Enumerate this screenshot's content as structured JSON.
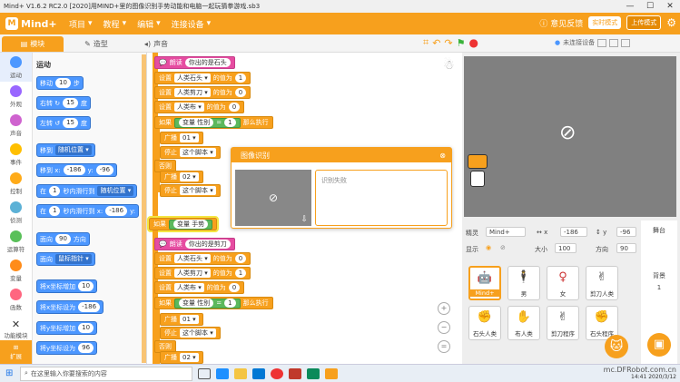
{
  "titlebar": {
    "title": "Mind+ V1.6.2 RC2.0   [2020]用MIND+里的图像识别手势动能和电脑一起玩猜拳游戏.sb3",
    "min": "—",
    "max": "☐",
    "close": "✕"
  },
  "menubar": {
    "logo": "Mind+",
    "items": [
      "项目",
      "教程",
      "编辑",
      "连接设备"
    ],
    "feedback": "意见反馈",
    "mode_active": "实时模式",
    "mode_upload": "上传模式"
  },
  "tabs": {
    "blocks": "模块",
    "costumes": "造型",
    "sounds": "声音"
  },
  "categories": [
    {
      "label": "运动",
      "color": "#4c97ff"
    },
    {
      "label": "外观",
      "color": "#9966ff"
    },
    {
      "label": "声音",
      "color": "#cf63cf"
    },
    {
      "label": "事件",
      "color": "#ffbf00"
    },
    {
      "label": "控制",
      "color": "#ffab19"
    },
    {
      "label": "侦测",
      "color": "#5cb1d6"
    },
    {
      "label": "运算符",
      "color": "#59c059"
    },
    {
      "label": "变量",
      "color": "#ff8c1a"
    },
    {
      "label": "函数",
      "color": "#ff6680"
    },
    {
      "label": "功能模块",
      "color": "#333333"
    }
  ],
  "extension_label": "扩展",
  "palette": {
    "heading": "运动",
    "blocks": [
      {
        "t1": "移动",
        "v": "10",
        "t2": "步"
      },
      {
        "t1": "右转 ↻",
        "v": "15",
        "t2": "度"
      },
      {
        "t1": "左转 ↺",
        "v": "15",
        "t2": "度"
      },
      {
        "t1": "移到",
        "d": "随机位置 ▾"
      },
      {
        "t1": "移到 x:",
        "v": "-186",
        "t2": "y:",
        "v2": "-96"
      },
      {
        "t1": "在",
        "v": "1",
        "t2": "秒内滑行到",
        "d": "随机位置 ▾"
      },
      {
        "t1": "在",
        "v": "1",
        "t2": "秒内滑行到 x:",
        "v2": "-186",
        "t3": "y:"
      },
      {
        "t1": "面向",
        "v": "90",
        "t2": "方向"
      },
      {
        "t1": "面向",
        "d": "鼠标指针 ▾"
      },
      {
        "t1": "将x坐标增加",
        "v": "10"
      },
      {
        "t1": "将x坐标设为",
        "v": "-186"
      },
      {
        "t1": "将y坐标增加",
        "v": "10"
      },
      {
        "t1": "将y坐标设为",
        "v": "96"
      }
    ]
  },
  "script": {
    "say1": "朗读",
    "say1_val": "你出的是石头",
    "set": "设置",
    "to": "的值为",
    "var_rock": "人类石头 ▾",
    "var_scissor": "人类剪刀 ▾",
    "var_cloth": "人类布 ▾",
    "v1": "1",
    "v0": "0",
    "if": "如果",
    "then": "那么执行",
    "else": "否则",
    "var_gender": "变量 性别",
    "eq": "=",
    "eq1": "1",
    "broadcast": "广播",
    "b01": "01 ▾",
    "b02": "02 ▾",
    "stop": "停止",
    "stop_opt": "这个脚本 ▾",
    "var_hand": "变量 手势",
    "say2_val": "你出的是剪刀"
  },
  "popup": {
    "title": "图像识别",
    "close": "⊗",
    "result": "识别失败",
    "cam_icon": "⊘"
  },
  "zoom": {
    "in": "+",
    "out": "−",
    "reset": "="
  },
  "stage": {
    "connect_status": "未连接设备",
    "no_cam": "⊘"
  },
  "sprite_info": {
    "sprite_label": "精灵",
    "sprite_name": "Mind+",
    "x_label": "↔ x",
    "x": "-186",
    "y_label": "↕ y",
    "y": "-96",
    "show": "显示",
    "size_label": "大小",
    "size": "100",
    "dir_label": "方向",
    "dir": "90"
  },
  "sprites": [
    "Mind+",
    "男",
    "女",
    "剪刀人类",
    "石头人类",
    "布人类",
    "剪刀程序",
    "石头程序"
  ],
  "stage_col": {
    "title": "舞台",
    "bg_label": "背景",
    "bg_count": "1"
  },
  "taskbar": {
    "search": "在这里输入你要搜索的内容",
    "time": "14:41",
    "date": "2020/3/12",
    "watermark": "mc.DFRobot.com.cn"
  }
}
